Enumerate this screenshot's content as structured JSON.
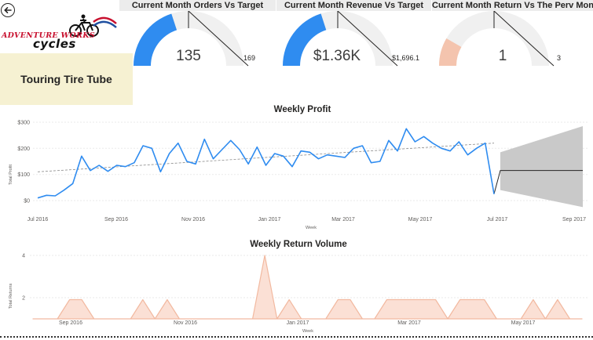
{
  "nav": {
    "back_icon": "back-arrow-icon"
  },
  "logo": {
    "top_text": "ADVENTURE WORKS",
    "bottom_text": "cycles"
  },
  "product": {
    "name": "Touring Tire Tube"
  },
  "gauges": [
    {
      "title": "Current Month Orders Vs Target",
      "value_label": "135",
      "target_label": "169",
      "value": 135,
      "target": 169,
      "fill_color": "#2f8cf0"
    },
    {
      "title": "Current Month Revenue Vs Target",
      "value_label": "$1.36K",
      "target_label": "$1,696.1",
      "value": 1360,
      "target": 1696.1,
      "fill_color": "#2f8cf0"
    },
    {
      "title": "Current Month Return Vs The Perv Month",
      "value_label": "1",
      "target_label": "3",
      "value": 1,
      "target": 3,
      "fill_color": "#f4c4ae"
    }
  ],
  "profit_chart": {
    "title": "Weekly Profit",
    "xlabel": "Week",
    "ylabel": "Total Profit",
    "y_ticks": [
      "$0",
      "$100",
      "$200",
      "$300"
    ],
    "x_ticks": [
      "Jul 2016",
      "Sep 2016",
      "Nov 2016",
      "Jan 2017",
      "Mar 2017",
      "May 2017",
      "Jul 2017",
      "Sep 2017"
    ]
  },
  "returns_chart": {
    "title": "Weekly Return Volume",
    "xlabel": "Week",
    "ylabel": "Total Returns",
    "y_ticks": [
      "2",
      "4"
    ],
    "x_ticks": [
      "Sep 2016",
      "Nov 2016",
      "Jan 2017",
      "Mar 2017",
      "May 2017"
    ]
  },
  "chart_data": [
    {
      "type": "line",
      "title": "Weekly Profit",
      "xlabel": "Week",
      "ylabel": "Total Profit",
      "ylim": [
        0,
        300
      ],
      "x_range": [
        "2016-07-01",
        "2017-09-01"
      ],
      "series": [
        {
          "values": [
            10,
            20,
            18,
            40,
            65,
            170,
            115,
            135,
            112,
            135,
            130,
            145,
            210,
            200,
            110,
            180,
            220,
            150,
            140,
            235,
            160,
            195,
            230,
            195,
            140,
            205,
            135,
            180,
            170,
            130,
            190,
            185,
            160,
            175,
            170,
            165,
            200,
            210,
            145,
            150,
            230,
            190,
            275,
            225,
            245,
            220,
            200,
            190,
            225,
            175,
            200,
            220,
            25
          ]
        }
      ],
      "trend_line": [
        110,
        220
      ],
      "forecast": {
        "value": 115,
        "lower_start": 185,
        "upper_start": 40,
        "lower_end": 285,
        "upper_end": -25
      }
    },
    {
      "type": "area",
      "title": "Weekly Return Volume",
      "xlabel": "Week",
      "ylabel": "Total Returns",
      "ylim": [
        1,
        4.3
      ],
      "values": [
        1,
        1,
        1,
        2,
        1,
        1,
        1,
        1,
        1,
        1,
        1,
        1,
        1,
        1,
        1,
        1,
        1,
        1,
        1,
        1,
        1,
        1,
        1,
        1,
        1,
        1,
        1,
        1,
        1,
        1,
        1,
        1,
        1,
        1,
        1,
        1,
        1,
        1,
        1,
        1,
        1,
        1,
        1,
        1,
        1,
        1
      ]
    }
  ]
}
